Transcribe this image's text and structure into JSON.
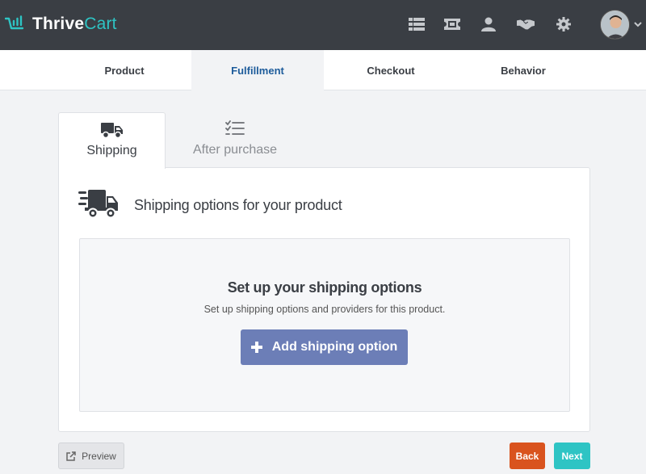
{
  "app": {
    "brand_primary": "Thrive",
    "brand_accent": "Cart",
    "accent_color": "#2ec4c4"
  },
  "top_icons": [
    "grid-table-icon",
    "ticket-icon",
    "user-icon",
    "handshake-icon",
    "gear-icon"
  ],
  "steps": [
    {
      "label": "Product",
      "active": false
    },
    {
      "label": "Fulfillment",
      "active": true
    },
    {
      "label": "Checkout",
      "active": false
    },
    {
      "label": "Behavior",
      "active": false
    }
  ],
  "tabs": [
    {
      "label": "Shipping",
      "icon": "truck-icon",
      "active": true
    },
    {
      "label": "After purchase",
      "icon": "checklist-icon",
      "active": false
    }
  ],
  "panel": {
    "title": "Shipping options for your product",
    "icon": "fast-truck-icon",
    "empty_title": "Set up your shipping options",
    "empty_subtitle": "Set up shipping options and providers for this product.",
    "add_button": "Add shipping option",
    "add_button_color": "#6c7eb7"
  },
  "footer": {
    "preview": "Preview",
    "back": "Back",
    "next": "Next",
    "back_color": "#d9531e",
    "next_color": "#2ec4c4"
  }
}
